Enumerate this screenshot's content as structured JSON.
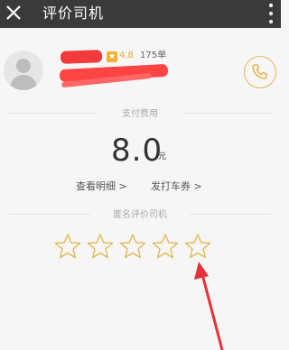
{
  "header": {
    "title": "评价司机",
    "close_icon": "close-icon",
    "menu_icon": "more-vertical-icon"
  },
  "driver": {
    "rating": "4.8",
    "order_count": "175单",
    "avatar_icon": "default-avatar-icon",
    "badge_icon": "star-badge-icon"
  },
  "payment": {
    "section_label": "支付费用",
    "amount": "8.0",
    "unit": "元",
    "details_link": "查看明细 >",
    "voucher_link": "发打车券 >"
  },
  "rating_section": {
    "label": "匿名评价司机",
    "stars": [
      {
        "icon": "star-outline-icon"
      },
      {
        "icon": "star-outline-icon"
      },
      {
        "icon": "star-outline-icon"
      },
      {
        "icon": "star-outline-icon"
      },
      {
        "icon": "star-outline-icon"
      }
    ]
  },
  "colors": {
    "header_bg": "#3a3a3a",
    "accent": "#e3b954",
    "annotation_red": "#e8303a"
  }
}
